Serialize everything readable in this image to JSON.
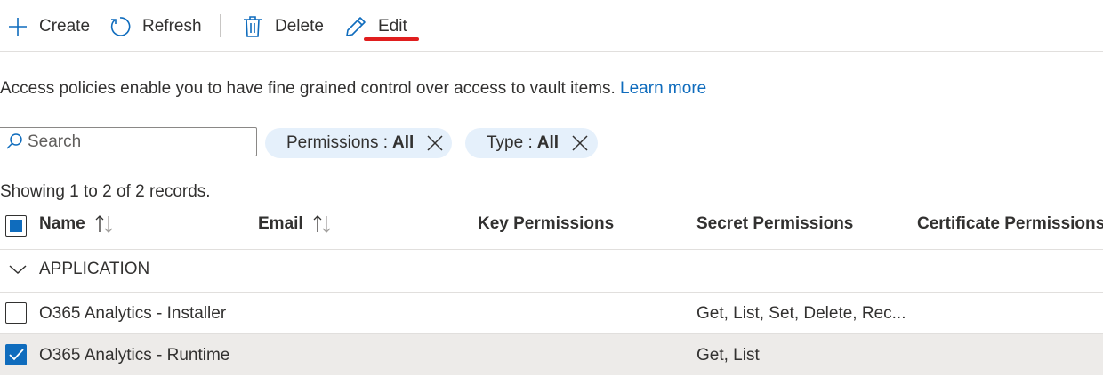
{
  "toolbar": {
    "create_label": "Create",
    "refresh_label": "Refresh",
    "delete_label": "Delete",
    "edit_label": "Edit"
  },
  "description": {
    "text": "Access policies enable you to have fine grained control over access to vault items.",
    "link_text": "Learn more"
  },
  "filters": {
    "search_placeholder": "Search",
    "pills": [
      {
        "label": "Permissions :",
        "value": "All"
      },
      {
        "label": "Type :",
        "value": "All"
      }
    ]
  },
  "records_text": "Showing 1 to 2 of 2 records.",
  "table": {
    "columns": [
      "Name",
      "Email",
      "Key Permissions",
      "Secret Permissions",
      "Certificate Permissions"
    ],
    "group": "APPLICATION",
    "rows": [
      {
        "name": "O365 Analytics - Installer",
        "email": "",
        "key": "",
        "secret": "Get, List, Set, Delete, Rec...",
        "certificate": "",
        "selected": false
      },
      {
        "name": "O365 Analytics - Runtime",
        "email": "",
        "key": "",
        "secret": "Get, List",
        "certificate": "",
        "selected": true
      }
    ]
  },
  "colors": {
    "accent": "#0f6cbd",
    "pill_bg": "#e5f0fb",
    "highlight_underline": "#e01e1e",
    "selected_row": "#edebe9"
  }
}
